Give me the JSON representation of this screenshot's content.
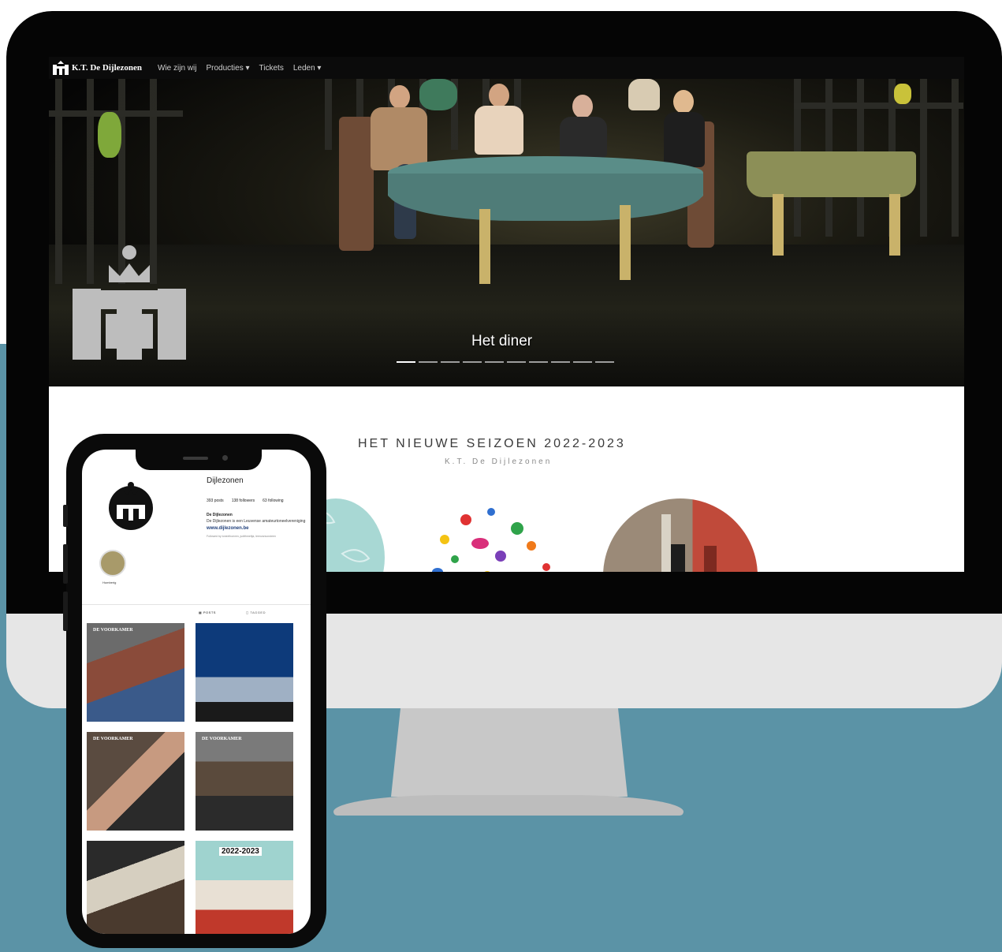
{
  "site": {
    "brand": "K.T. De Dijlezonen",
    "nav": [
      "Wie zijn wij",
      "Producties ▾",
      "Tickets",
      "Leden ▾"
    ],
    "hero_caption": "Het diner",
    "carousel_count": 10,
    "carousel_active": 0,
    "section_title": "HET NIEUWE SEIZOEN 2022-2023",
    "section_subtitle": "K.T. De Dijlezonen"
  },
  "instagram": {
    "username": "Dijlezonen",
    "posts": "393 posts",
    "followers": "138 followers",
    "following": "63 following",
    "bio_name": "De Dijlezonen",
    "bio": "De Dijlezonen is een Leuvense amateurtoneelvereniging",
    "link": "www.dijlezonen.be",
    "followed_by": "Followed by toneelhoeven, judithmeltja, leenvanvondeen",
    "highlight_label": "Humberig",
    "tabs": [
      "▦ POSTS",
      "◻ TAGGED"
    ],
    "grid_labels": [
      "DE VOORKAMER",
      "",
      "DE VOORKAMER",
      "DE VOORKAMER",
      "",
      "2022-2023"
    ]
  },
  "colors": {
    "background_band": "#5b93a6",
    "bezel": "#050505",
    "monitor_chin": "#e6e6e6",
    "nav_bar": "#0b0b0b"
  }
}
